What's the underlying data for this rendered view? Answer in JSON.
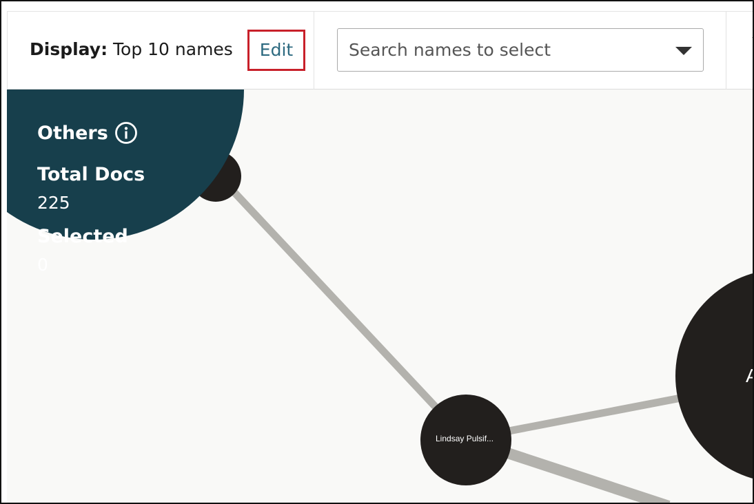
{
  "toolbar": {
    "display_prefix": "Display:",
    "display_value": "Top 10 names",
    "edit_label": "Edit",
    "search_placeholder": "Search names to select"
  },
  "others_panel": {
    "title": "Others",
    "total_docs_label": "Total Docs",
    "total_docs_value": "225",
    "selected_label": "Selected",
    "selected_value": "0"
  },
  "graph": {
    "nodes": [
      {
        "id": "lindsay",
        "label": "Lindsay Pulsif..."
      },
      {
        "id": "large",
        "label": "A"
      },
      {
        "id": "small-top",
        "label": ""
      }
    ]
  },
  "colors": {
    "others_fill": "#173f4c",
    "node_fill": "#221f1d",
    "edge": "#b3b2ad",
    "edit_link": "#2d6a80",
    "highlight_border": "#c8202a",
    "canvas_bg": "#f9f9f7"
  }
}
